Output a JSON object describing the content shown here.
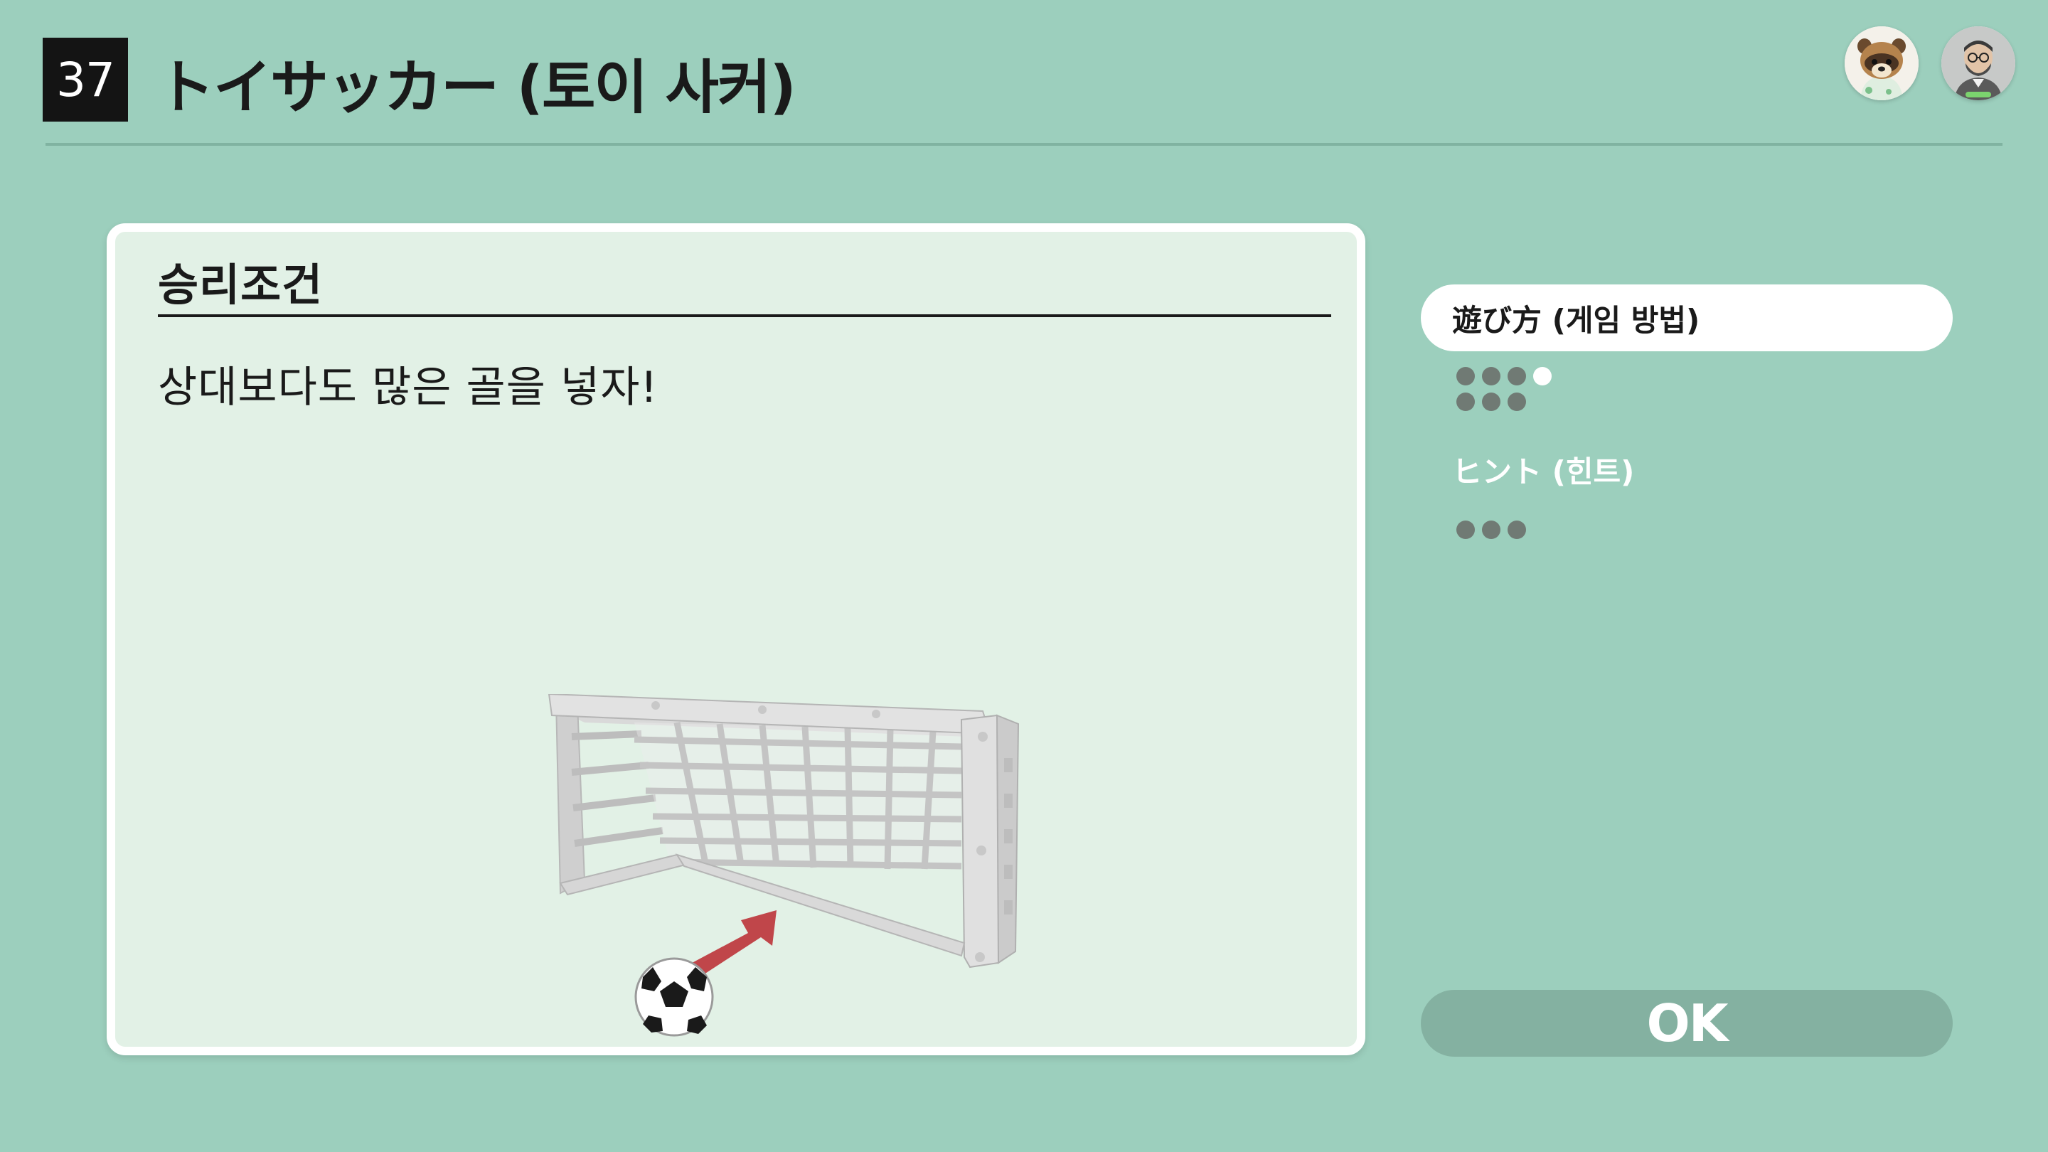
{
  "header": {
    "number": "37",
    "title": "トイサッカー (토이 사커)"
  },
  "players": [
    {
      "name": "raccoon-character-avatar"
    },
    {
      "name": "bearded-man-avatar"
    }
  ],
  "card": {
    "heading": "승리조건",
    "body": "상대보다도 많은 골을 넣자!"
  },
  "side_menu": {
    "how_to_play": "遊び方 (게임 방법)",
    "hint": "ヒント (힌트)",
    "ok": "OK"
  },
  "colors": {
    "background": "#9ccfbd",
    "card": "#e2f1e6",
    "ok_button": "#84b1a1",
    "arrow": "#c0464a"
  }
}
